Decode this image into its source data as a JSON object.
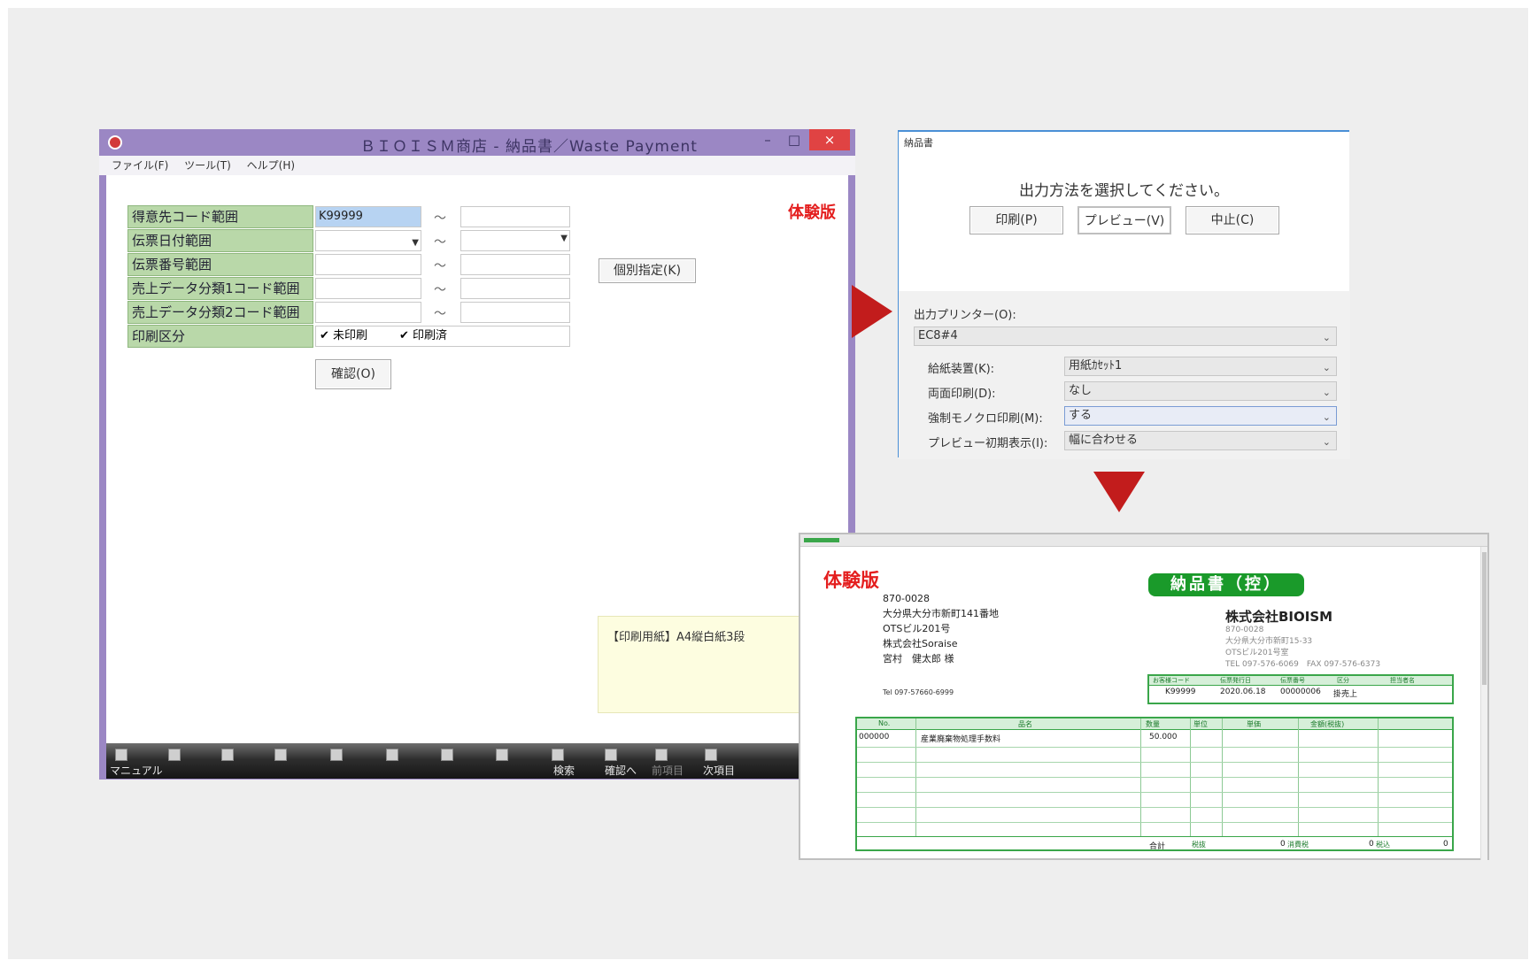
{
  "main_window": {
    "title": "ＢＩＯＩＳＭ商店 - 納品書／Waste Payment",
    "controls": {
      "minimize": "–",
      "maximize": "□",
      "close": "×"
    },
    "menu": [
      "ファイル(F)",
      "ツール(T)",
      "ヘルプ(H)"
    ],
    "trial_label": "体験版",
    "form": {
      "rows": [
        {
          "label": "得意先コード範囲",
          "from": "K99999",
          "to": "",
          "type": "text"
        },
        {
          "label": "伝票日付範囲",
          "from": "",
          "to": "",
          "type": "date"
        },
        {
          "label": "伝票番号範囲",
          "from": "",
          "to": "",
          "type": "text"
        },
        {
          "label": "売上データ分類1コード範囲",
          "from": "",
          "to": "",
          "type": "text"
        },
        {
          "label": "売上データ分類2コード範囲",
          "from": "",
          "to": "",
          "type": "text"
        }
      ],
      "range_separator": "～",
      "print_class": {
        "label": "印刷区分",
        "unprinted": "✔ 未印刷",
        "printed": "✔ 印刷済"
      },
      "confirm_button": "確認(O)",
      "individual_button": "個別指定(K)"
    },
    "note": "【印刷用紙】A4縦白紙3段",
    "fkeys": [
      {
        "label": "マニュアル"
      },
      {
        "label": ""
      },
      {
        "label": ""
      },
      {
        "label": ""
      },
      {
        "label": ""
      },
      {
        "label": ""
      },
      {
        "label": ""
      },
      {
        "label": ""
      },
      {
        "label": "検索"
      },
      {
        "label": "確認へ"
      },
      {
        "label": "前項目"
      },
      {
        "label": "次項目"
      }
    ]
  },
  "dialog": {
    "title": "納品書",
    "prompt": "出力方法を選択してください。",
    "buttons": {
      "print": "印刷(P)",
      "preview": "プレビュー(V)",
      "cancel": "中止(C)"
    },
    "printer_label": "出力プリンター(O):",
    "printer_value": "EC8#4",
    "options": [
      {
        "label": "給紙装置(K):",
        "value": "用紙ｶｾｯﾄ1"
      },
      {
        "label": "両面印刷(D):",
        "value": "なし"
      },
      {
        "label": "強制モノクロ印刷(M):",
        "value": "する"
      },
      {
        "label": "プレビュー初期表示(I):",
        "value": "幅に合わせる"
      }
    ]
  },
  "preview": {
    "trial_label": "体験版",
    "recipient": {
      "zip": "870-0028",
      "address1": "大分県大分市新町141番地",
      "address2": "OTSビル201号",
      "company": "株式会社Soraise",
      "person": "宮村　健太郎 様"
    },
    "tel": "Tel 097-57660-6999",
    "doc_title": "納品書（控）",
    "issuer": {
      "company": "株式会社BIOISM",
      "zip": "870-0028",
      "address": "大分県大分市新町15-33",
      "building": "OTSビル201号室",
      "tel_fax": "TEL 097-576-6069　FAX 097-576-6373"
    },
    "info_headers": [
      "お客様コード",
      "伝票発行日",
      "伝票番号",
      "区分",
      "担当者名"
    ],
    "info_values": [
      "K99999",
      "2020.06.18",
      "00000006",
      "掛売上",
      ""
    ],
    "item_headers": [
      "No.",
      "品名",
      "数量",
      "単位",
      "単価",
      "金額(税抜)"
    ],
    "item_row": {
      "no": "000000",
      "name": "産業廃棄物処理手数料",
      "qty": "50.000"
    },
    "totals": {
      "label": "合計",
      "tag1": "税抜",
      "value1": "0",
      "tag2": "消費税",
      "value2": "0",
      "tag3": "税込",
      "value3": "0"
    }
  },
  "colors": {
    "window_frame": "#9b87c4",
    "label_green": "#b9d8a9",
    "arrow_red": "#c21c1c",
    "trial_red": "#e41e1e",
    "doc_green": "#1a9a2a"
  }
}
